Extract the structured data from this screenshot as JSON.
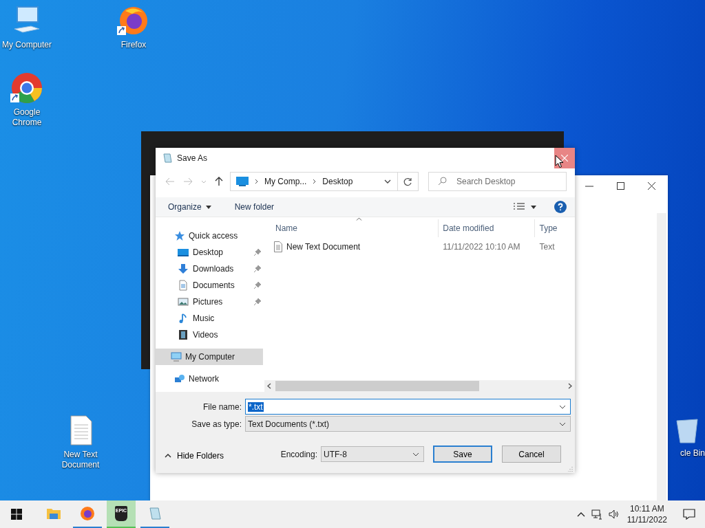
{
  "desktop_icons": [
    {
      "kind": "computer",
      "label": "My Computer",
      "shortcut": false
    },
    {
      "kind": "firefox",
      "label": "Firefox",
      "shortcut": true
    },
    {
      "kind": "chrome",
      "label": "Google Chrome",
      "shortcut": true
    },
    {
      "kind": "textfile",
      "label": "New Text Document",
      "shortcut": false
    },
    {
      "kind": "recyclebin",
      "label": "cle Bin",
      "shortcut": false
    }
  ],
  "dialog": {
    "title": "Save As",
    "breadcrumb": [
      "My Comp...",
      "Desktop"
    ],
    "search": {
      "placeholder": "Search Desktop"
    },
    "toolbar": {
      "organize": "Organize",
      "new_folder": "New folder"
    },
    "nav": [
      {
        "kind": "star",
        "label": "Quick access",
        "selected": false,
        "children": [
          {
            "kind": "desktop",
            "label": "Desktop",
            "selected": false,
            "pinned": true
          },
          {
            "kind": "download",
            "label": "Downloads",
            "selected": false,
            "pinned": true
          },
          {
            "kind": "document",
            "label": "Documents",
            "selected": false,
            "pinned": true
          },
          {
            "kind": "pictures",
            "label": "Pictures",
            "selected": false,
            "pinned": true
          },
          {
            "kind": "music",
            "label": "Music",
            "selected": false,
            "pinned": false
          },
          {
            "kind": "videos",
            "label": "Videos",
            "selected": false,
            "pinned": false
          }
        ]
      },
      {
        "kind": "computer",
        "label": "My Computer",
        "selected": true
      },
      {
        "kind": "network",
        "label": "Network",
        "selected": false
      }
    ],
    "columns": [
      "Name",
      "Date modified",
      "Type"
    ],
    "files": [
      {
        "name": "New Text Document",
        "date": "11/11/2022 10:10 AM",
        "type": "Text"
      }
    ],
    "file_name": {
      "label": "File name:",
      "value": "*.txt"
    },
    "save_type": {
      "label": "Save as type:",
      "value": "Text Documents (*.txt)"
    },
    "hide_folders": "Hide Folders",
    "encoding": {
      "label": "Encoding:",
      "value": "UTF-8"
    },
    "buttons": [
      {
        "kind": "primary",
        "label": "Save"
      },
      {
        "kind": "normal",
        "label": "Cancel"
      }
    ]
  },
  "taskbar": {
    "apps": [
      {
        "kind": "explorer",
        "running": false,
        "selected": false
      },
      {
        "kind": "firefox",
        "running": true,
        "selected": false
      },
      {
        "kind": "epic",
        "label": "EPIC",
        "running": true,
        "selected": true
      },
      {
        "kind": "notepad",
        "running": true,
        "selected": false
      }
    ],
    "time": "10:11 AM",
    "date": "11/11/2022"
  }
}
